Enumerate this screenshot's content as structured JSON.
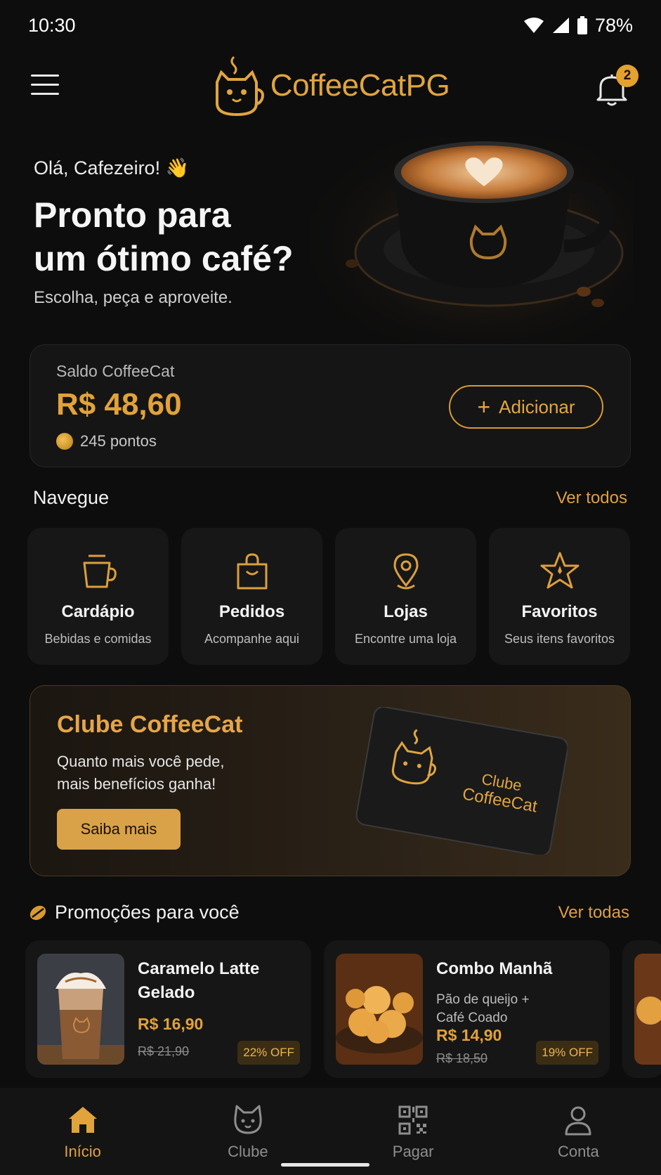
{
  "status_bar": {
    "time": "10:30",
    "battery": "78%"
  },
  "header": {
    "app_name": "CoffeeCatPG",
    "notification_count": "2"
  },
  "hero": {
    "greeting": "Olá, Cafezeiro! 👋",
    "title_line1": "Pronto para",
    "title_line2": "um ótimo café?",
    "subtitle": "Escolha, peça e aproveite."
  },
  "balance": {
    "label": "Saldo CoffeeCat",
    "value": "R$ 48,60",
    "points": "245 pontos",
    "add_label": "Adicionar"
  },
  "navegue": {
    "title": "Navegue",
    "link": "Ver todos",
    "items": [
      {
        "title": "Cardápio",
        "subtitle": "Bebidas e comidas",
        "icon": "cup-icon"
      },
      {
        "title": "Pedidos",
        "subtitle": "Acompanhe aqui",
        "icon": "bag-icon"
      },
      {
        "title": "Lojas",
        "subtitle": "Encontre uma loja",
        "icon": "location-pin-icon"
      },
      {
        "title": "Favoritos",
        "subtitle": "Seus itens favoritos",
        "icon": "star-icon"
      }
    ]
  },
  "clube": {
    "title": "Clube CoffeeCat",
    "text_line1": "Quanto mais você pede,",
    "text_line2": "mais benefícios ganha!",
    "button": "Saiba mais",
    "card_line1": "Clube",
    "card_line2": "CoffeeCat"
  },
  "promos": {
    "title": "Promoções para você",
    "link": "Ver todas",
    "items": [
      {
        "name_line1": "Caramelo Latte",
        "name_line2": "Gelado",
        "desc_line1": "",
        "desc_line2": "",
        "price": "R$ 16,90",
        "old_price": "R$ 21,90",
        "discount": "22% OFF"
      },
      {
        "name_line1": "Combo Manhã",
        "name_line2": "",
        "desc_line1": "Pão de queijo +",
        "desc_line2": "Café Coado",
        "price": "R$ 14,90",
        "old_price": "R$ 18,50",
        "discount": "19% OFF"
      }
    ]
  },
  "bottom_nav": [
    {
      "label": "Início",
      "icon": "home-icon",
      "active": true
    },
    {
      "label": "Clube",
      "icon": "cat-icon",
      "active": false
    },
    {
      "label": "Pagar",
      "icon": "qr-code-icon",
      "active": false
    },
    {
      "label": "Conta",
      "icon": "user-icon",
      "active": false
    }
  ],
  "colors": {
    "accent": "#e2a23a",
    "background": "#0d0d0d",
    "card": "#161616"
  }
}
